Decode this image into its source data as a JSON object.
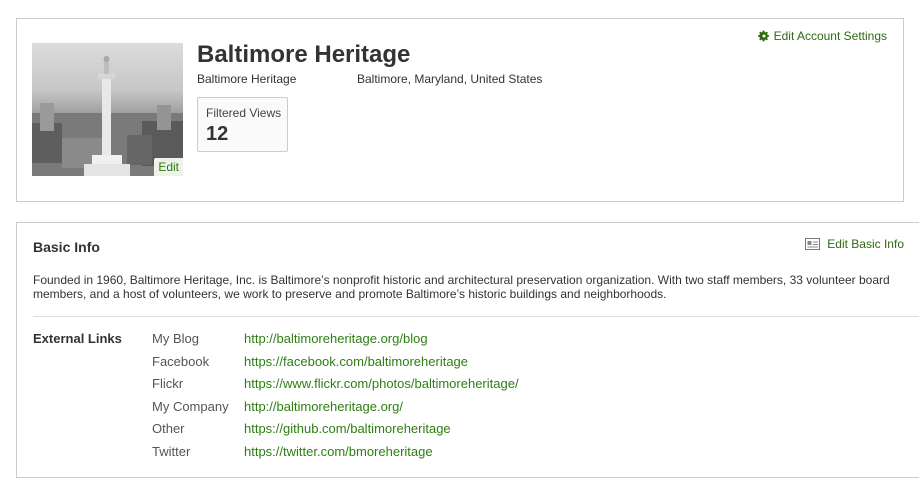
{
  "profile": {
    "name": "Baltimore Heritage",
    "subtitle": "Baltimore Heritage",
    "location": "Baltimore, Maryland, United States",
    "photo_edit_label": "Edit",
    "stat": {
      "label": "Filtered Views",
      "value": "12"
    },
    "edit_account_label": "Edit Account Settings",
    "edit_account_icon": "gear-icon"
  },
  "basic_info": {
    "title": "Basic Info",
    "edit_label": "Edit Basic Info",
    "edit_icon": "id-card-icon",
    "description": "Founded in 1960, Baltimore Heritage, Inc. is Baltimore’s nonprofit historic and architectural preservation organization. With two staff members, 33 volunteer board members, and a host of volunteers, we work to preserve and promote Baltimore’s historic buildings and neighborhoods.",
    "external_links_label": "External Links",
    "links": [
      {
        "name": "My Blog",
        "url": "http://baltimoreheritage.org/blog"
      },
      {
        "name": "Facebook",
        "url": "https://facebook.com/baltimoreheritage"
      },
      {
        "name": "Flickr",
        "url": "https://www.flickr.com/photos/baltimoreheritage/"
      },
      {
        "name": "My Company",
        "url": "http://baltimoreheritage.org/"
      },
      {
        "name": "Other",
        "url": "https://github.com/baltimoreheritage"
      },
      {
        "name": "Twitter",
        "url": "https://twitter.com/bmoreheritage"
      }
    ]
  },
  "colors": {
    "link": "#2d7f12",
    "border": "#cccccc",
    "text": "#333333"
  }
}
